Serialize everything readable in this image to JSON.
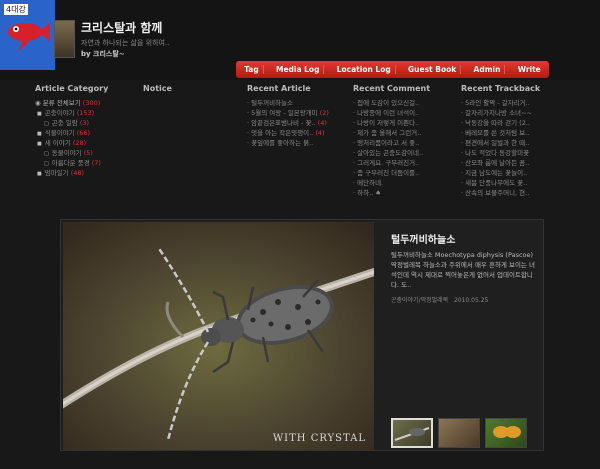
{
  "header": {
    "logo_tag": "4대강",
    "title": "크리스탈과 함께",
    "description": "자연과 하나되는 삶을 위하여..",
    "by_label": "by",
    "author": "크리스탈~"
  },
  "nav": [
    "Tag",
    "Media Log",
    "Location Log",
    "Guest Book",
    "Admin",
    "Write"
  ],
  "category": {
    "heading": "Article Category",
    "root": {
      "label": "분류 전체보기",
      "count": "(300)"
    },
    "items": [
      {
        "label": "곤충이야기",
        "count": "(153)",
        "sub": false
      },
      {
        "label": "곤충 일람",
        "count": "(3)",
        "sub": true
      },
      {
        "label": "식물이야기",
        "count": "(66)",
        "sub": false
      },
      {
        "label": "새 이야기",
        "count": "(28)",
        "sub": false
      },
      {
        "label": "동물이야기",
        "count": "(5)",
        "sub": false
      },
      {
        "label": "아름다운 풍경",
        "count": "(7)",
        "sub": false
      },
      {
        "label": "멈마일기",
        "count": "(48)",
        "sub": false
      }
    ]
  },
  "notice": {
    "heading": "Notice"
  },
  "recent_article": {
    "heading": "Recent Article",
    "items": [
      {
        "label": "털두꺼비하늘소",
        "count": ""
      },
      {
        "label": "5월의 여왕 - 일본왕개미",
        "count": "(2)"
      },
      {
        "label": "암끝검은표범나비 - 꽃..",
        "count": "(4)"
      },
      {
        "label": "멋을 아는 작은멋쟁이..",
        "count": "(4)"
      },
      {
        "label": "꽃잎에를 좋아하는 붉..",
        "count": ""
      }
    ]
  },
  "recent_comment": {
    "heading": "Recent Comment",
    "items": [
      "접에 도감이 있으신걸..",
      "나방종에 이런 녀석이..",
      "나방이 저렇게 이쁜다..",
      "제가 좀 올해서 그런거..",
      "맹처리품이라고 서 좋..",
      "살아있는 곤충도감이네..",
      "그러게요. 구부러진거..",
      "좀 구부러진 더듬이를..",
      "메단하네.",
      "하하.. ♠"
    ]
  },
  "recent_trackback": {
    "heading": "Recent Trackback",
    "items": [
      "5라인 활짝 - 갈자리거..",
      "갈자리가지나방 소녀~~",
      "낙동강을 따라 걷기 (2..",
      "베레모를 쓴 것처럼 보..",
      "편견에서 일벌과 한 때..",
      "나도 적었다 동강할미꽃",
      "산모좌 룸에 날아든 꼼..",
      "지금 남도에는 꽃놀이..",
      "새봄 단풍나무에도 꽃..",
      "산속의 보물주머니, 현.."
    ]
  },
  "featured": {
    "title": "털두꺼비하늘소",
    "description": "털두꺼비하늘소 Moechotypa diphysis (Pascoe) 딱정벌레목 하늘소과 주위에서 매우 흔하게 보이는 녀석인데 역시 제대로 찍어놓은게 없어서 업데이트합니다. 도..",
    "meta_category": "곤충이야기/딱정벌레목",
    "meta_date": "2010.05.25",
    "watermark": "WITH CRYSTAL"
  }
}
